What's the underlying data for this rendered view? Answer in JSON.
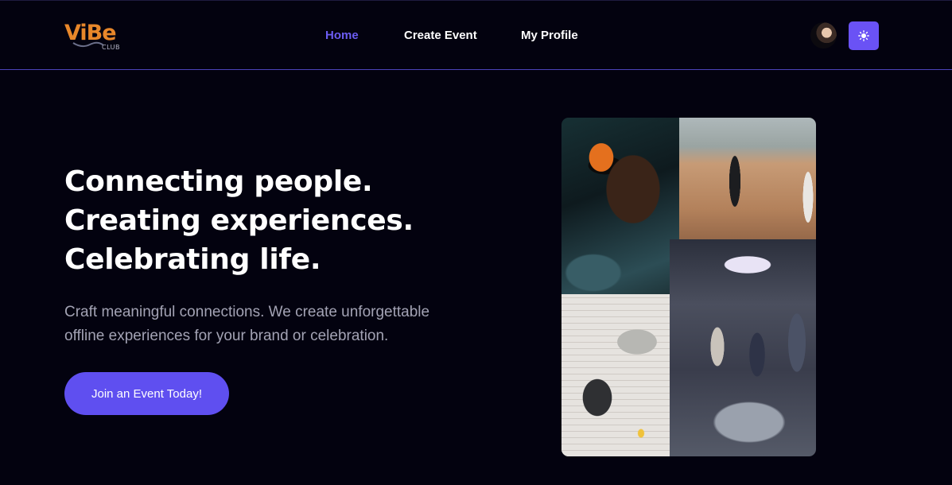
{
  "brand": {
    "logo_word": "ViBe",
    "logo_sub": "CLUB",
    "logo_color": "#e8872a"
  },
  "nav": {
    "items": [
      {
        "label": "Home",
        "active": true
      },
      {
        "label": "Create Event",
        "active": false
      },
      {
        "label": "My Profile",
        "active": false
      }
    ],
    "active_color": "#6b5cf2"
  },
  "header": {
    "avatar_icon": "user-avatar",
    "theme_toggle_icon": "sun-icon",
    "theme_toggle_color": "#6a52f5"
  },
  "hero": {
    "title_lines": [
      "Connecting people.",
      "Creating experiences.",
      "Celebrating life."
    ],
    "subtitle_line1": "Craft meaningful connections. We create unforgettable",
    "subtitle_line2": "offline experiences for your brand or celebration.",
    "cta_label": "Join an Event Today!",
    "cta_color": "#5f4ff0"
  },
  "collage": {
    "photos": [
      "party-photo",
      "beach-cricket-photo",
      "laptops-table-photo",
      "kitchen-gathering-photo"
    ]
  },
  "theme": {
    "background": "#03020f",
    "divider": "#4b43b8"
  }
}
